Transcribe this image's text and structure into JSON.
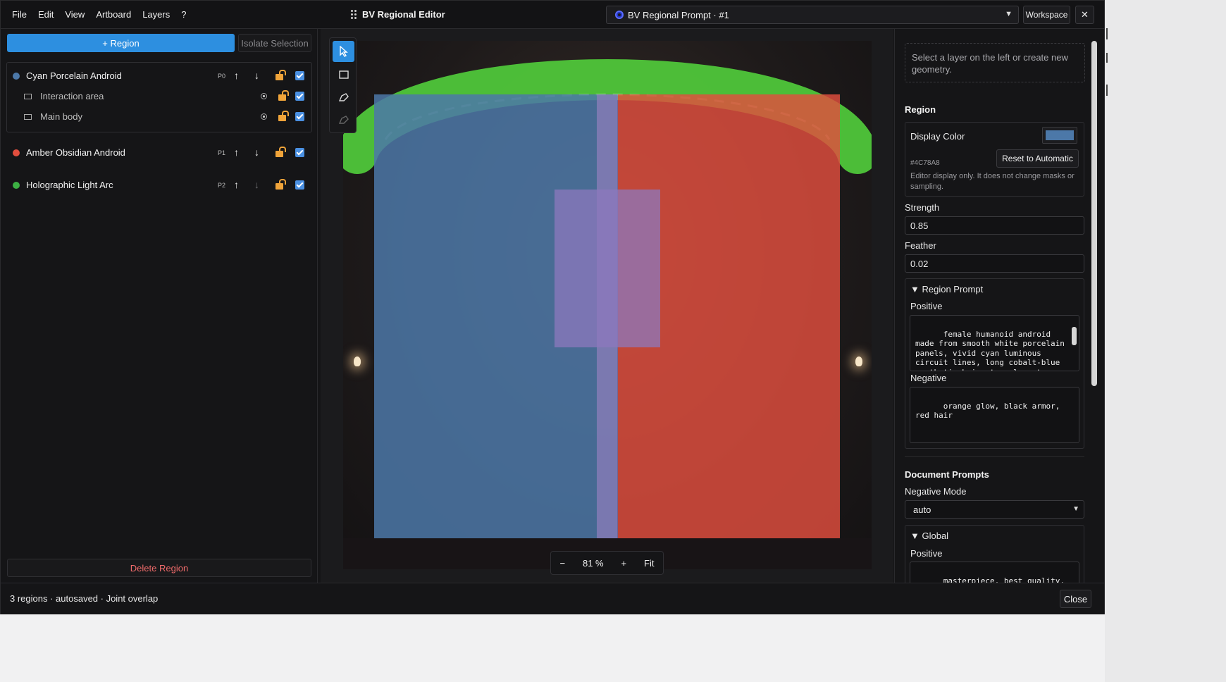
{
  "menu": [
    "File",
    "Edit",
    "View",
    "Artboard",
    "Layers",
    "?"
  ],
  "app_title": "BV Regional Editor",
  "prompt_select": "BV Regional Prompt · #1",
  "workspace_label": "Workspace",
  "close_x": "✕",
  "left": {
    "add_region": "+ Region",
    "isolate": "Isolate Selection",
    "regions": [
      {
        "name": "Cyan Porcelain Android",
        "tag": "P0",
        "color": "#4c78a8",
        "children": [
          {
            "name": "Interaction area"
          },
          {
            "name": "Main body"
          }
        ]
      },
      {
        "name": "Amber Obsidian Android",
        "tag": "P1",
        "color": "#e24e3e",
        "children": []
      },
      {
        "name": "Holographic Light Arc",
        "tag": "P2",
        "color": "#3cb043",
        "children": []
      }
    ],
    "delete": "Delete Region"
  },
  "canvas": {
    "zoom_minus": "−",
    "zoom_value": "81 %",
    "zoom_plus": "+",
    "fit": "Fit"
  },
  "right": {
    "hint": "Select a layer on the left or create new geometry.",
    "region_title": "Region",
    "display_color_label": "Display Color",
    "display_color_hex": "#4C78A8",
    "reset_btn": "Reset to Automatic",
    "display_note": "Editor display only. It does not change masks or sampling.",
    "strength_label": "Strength",
    "strength": "0.85",
    "feather_label": "Feather",
    "feather": "0.02",
    "region_prompt_title": "▼ Region Prompt",
    "positive_label": "Positive",
    "positive_text": "female humanoid android made from smooth white porcelain panels, vivid cyan luminous circuit lines, long cobalt-blue synthetic hair, translucent cyan fabric ribbons, elegant",
    "negative_label": "Negative",
    "negative_text": "orange glow, black armor, red hair",
    "doc_prompts_title": "Document Prompts",
    "neg_mode_label": "Negative Mode",
    "neg_mode": "auto",
    "global_title": "▼ Global",
    "global_positive_label": "Positive",
    "global_positive_text": "masterpiece, best quality, exactly two female humanoid"
  },
  "status": {
    "text": "3 regions · autosaved · Joint overlap",
    "close": "Close"
  }
}
